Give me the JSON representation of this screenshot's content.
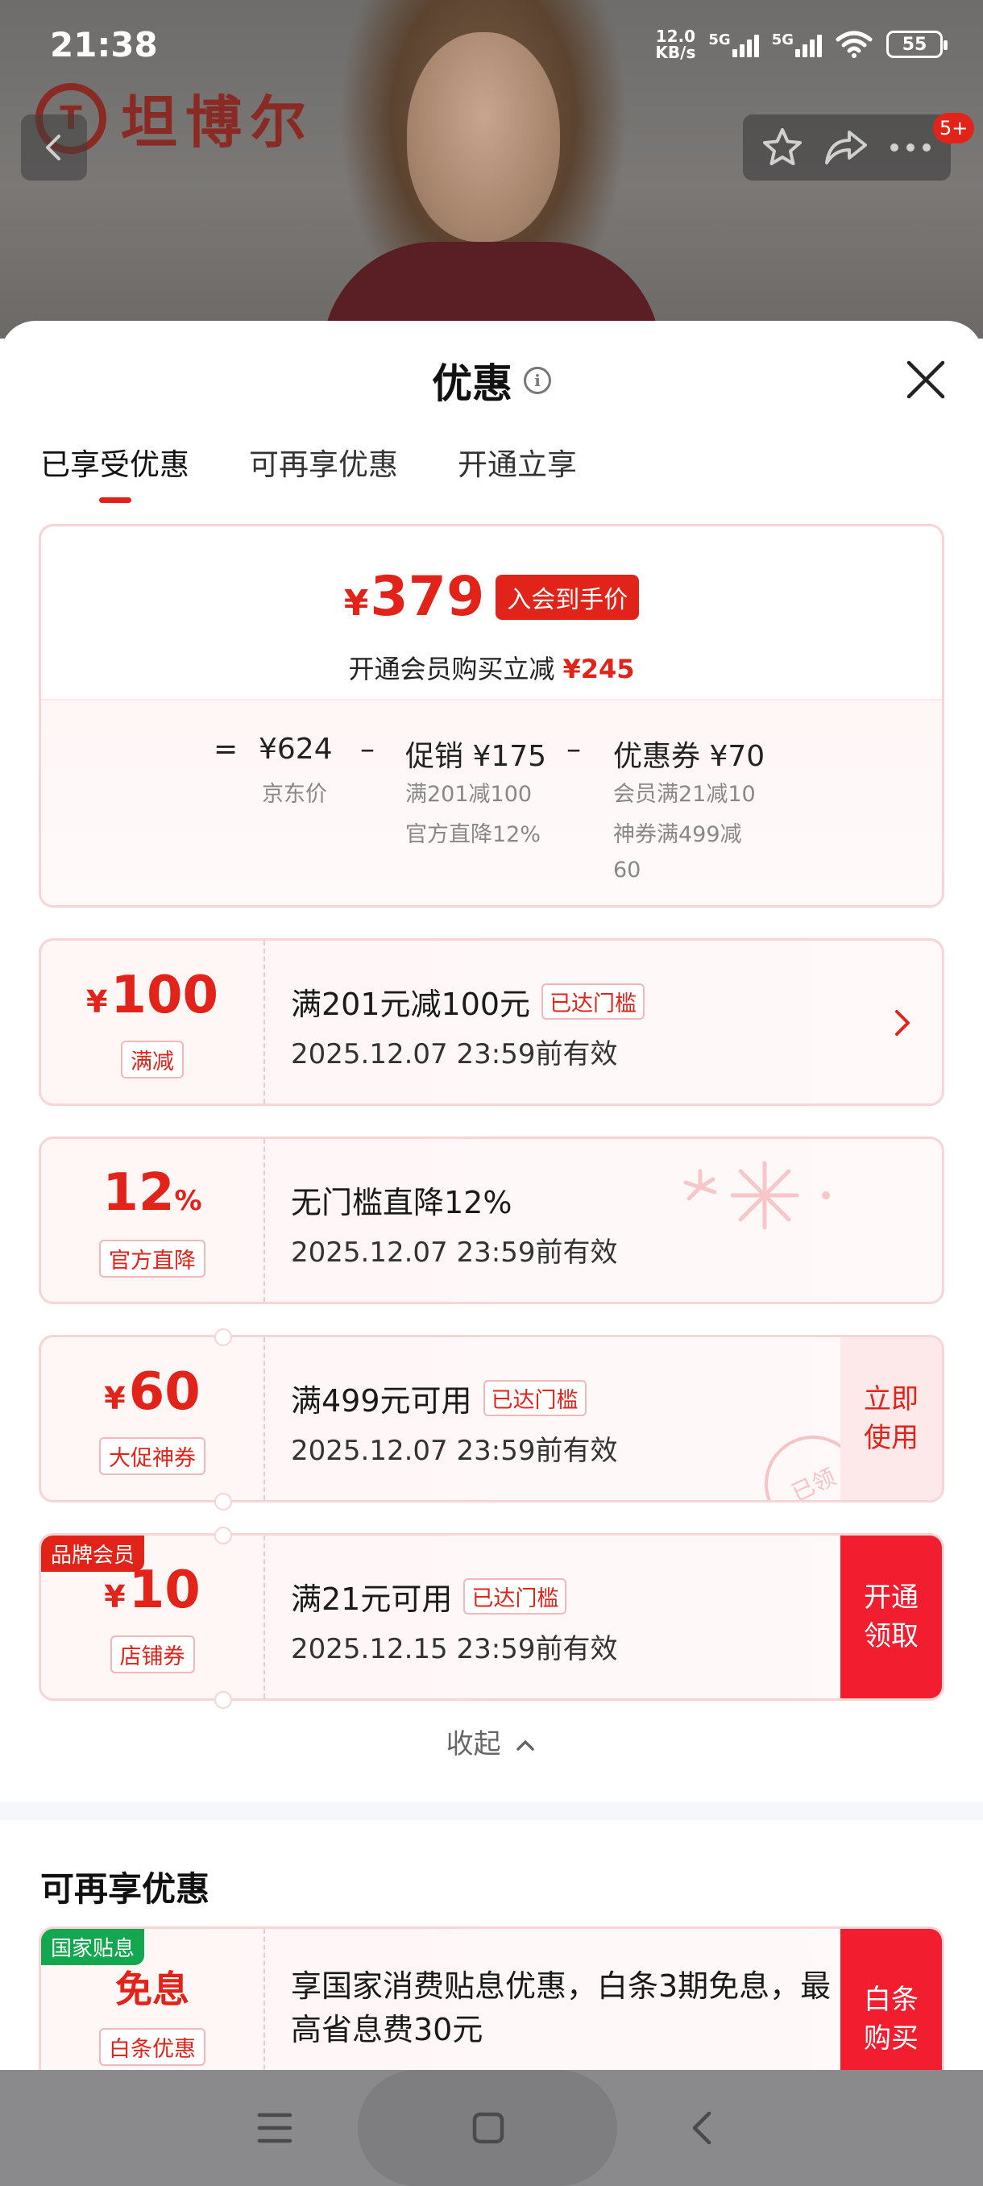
{
  "status_bar": {
    "time": "21:38",
    "net_speed_value": "12.0",
    "net_speed_unit": "KB/s",
    "sim1": "5G",
    "sim2": "5G",
    "battery": "55"
  },
  "background": {
    "brand_name": "坦博尔",
    "notification_badge": "5+"
  },
  "sheet": {
    "title": "优惠",
    "tabs": [
      {
        "label": "已享受优惠",
        "active": true
      },
      {
        "label": "可再享优惠",
        "active": false
      },
      {
        "label": "开通立享",
        "active": false
      }
    ]
  },
  "summary": {
    "currency": "¥",
    "final_price": "379",
    "member_tag": "入会到手价",
    "sub_text": "开通会员购买立减",
    "sub_amount": "¥245",
    "formula": {
      "equals": "=",
      "base_price": "¥624",
      "base_label": "京东价",
      "minus1": "–",
      "promo": "促销 ¥175",
      "promo_details": [
        "满201减100",
        "官方直降12%"
      ],
      "minus2": "–",
      "coupon": "优惠券 ¥70",
      "coupon_details": [
        "会员满21减10",
        "神券满499减",
        "60"
      ]
    }
  },
  "coupons": [
    {
      "currency": "¥",
      "value": "100",
      "type": "满减",
      "title": "满201元减100元",
      "threshold_tag": "已达门槛",
      "date": "2025.12.07 23:59前有效",
      "has_arrow": true
    },
    {
      "value": "12",
      "suffix": "%",
      "type": "官方直降",
      "title": "无门槛直降12%",
      "date": "2025.12.07 23:59前有效"
    },
    {
      "currency": "¥",
      "value": "60",
      "type": "大促神券",
      "title": "满499元可用",
      "threshold_tag": "已达门槛",
      "date": "2025.12.07 23:59前有效",
      "action": "立即使用",
      "stamp": "已领"
    },
    {
      "corner_tag": "品牌会员",
      "currency": "¥",
      "value": "10",
      "type": "店铺券",
      "title": "满21元可用",
      "threshold_tag": "已达门槛",
      "date": "2025.12.15 23:59前有效",
      "action": "开通领取"
    }
  ],
  "collapse_label": "收起",
  "more_section": {
    "title": "可再享优惠",
    "card": {
      "corner_tag": "国家贴息",
      "value": "免息",
      "type": "白条优惠",
      "text": "享国家消费贴息优惠，白条3期免息，最高省息费30元",
      "action": "白条购买"
    }
  },
  "colors": {
    "accent_red": "#e2231a",
    "action_red": "#f21d2f",
    "green_tag": "#13a84f",
    "card_border": "#f7d4d6"
  },
  "icons": [
    "back-arrow-icon",
    "star-icon",
    "share-icon",
    "more-icon",
    "info-icon",
    "close-icon",
    "chevron-right-icon",
    "chevron-up-icon",
    "menu-icon",
    "home-icon",
    "nav-back-icon"
  ]
}
